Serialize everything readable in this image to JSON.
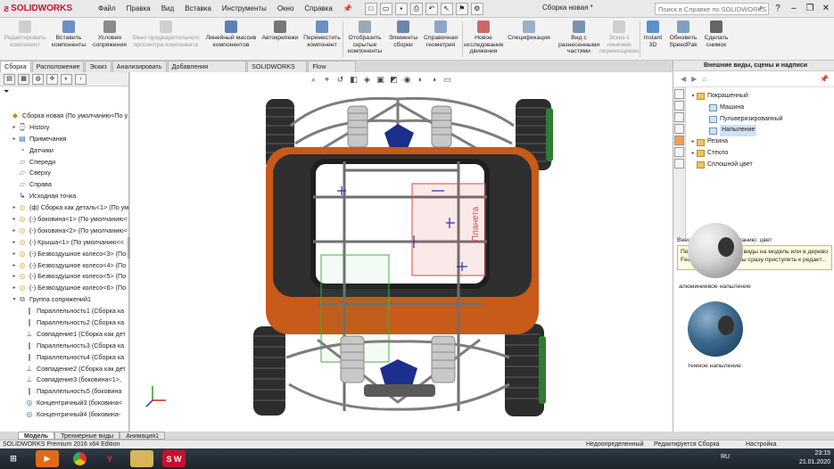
{
  "app": {
    "logo": "SOLIDWORKS",
    "doc_title": "Сборка новая *",
    "help_search_placeholder": "Поиск в Справке по SOLIDWORKS"
  },
  "menu": [
    "Файл",
    "Правка",
    "Вид",
    "Вставка",
    "Инструменты",
    "Окно",
    "Справка"
  ],
  "command_manager": [
    {
      "label": "Редактировать компонент",
      "enabled": false
    },
    {
      "label": "Вставить компоненты",
      "enabled": true
    },
    {
      "label": "Условия сопряжения",
      "enabled": true
    },
    {
      "label": "Окно предварительного просмотра компонента",
      "enabled": false
    },
    {
      "label": "Линейный массив компонентов",
      "enabled": true
    },
    {
      "label": "Автокрепежи",
      "enabled": true
    },
    {
      "label": "Переместить компонент",
      "enabled": true
    },
    {
      "label": "Отобразить скрытые компоненты",
      "enabled": true
    },
    {
      "label": "Элементы сборки",
      "enabled": true
    },
    {
      "label": "Справочная геометрия",
      "enabled": true
    },
    {
      "label": "Новое исследование движения",
      "enabled": true
    },
    {
      "label": "Спецификация",
      "enabled": true
    },
    {
      "label": "Вид с разнесенными частями",
      "enabled": true
    },
    {
      "label": "Эскиз с линиями перемещения",
      "enabled": false
    },
    {
      "label": "Instant 3D",
      "enabled": true
    },
    {
      "label": "Обновить SpeedPak",
      "enabled": true
    },
    {
      "label": "Сделать снимок",
      "enabled": true
    }
  ],
  "command_tabs": [
    "Сборка",
    "Расположение",
    "Эскиз",
    "Анализировать",
    "Добавления SOLIDWORKS",
    "SOLIDWORKS MBD",
    "Flow Simulation"
  ],
  "feature_tree": [
    {
      "label": "Сборка новая  (По умолчанию<По у",
      "level": 0,
      "twist": "",
      "icon": "assembly"
    },
    {
      "label": "History",
      "level": 1,
      "twist": "▸",
      "icon": "history"
    },
    {
      "label": "Примечания",
      "level": 1,
      "twist": "▸",
      "icon": "notes"
    },
    {
      "label": "Датчики",
      "level": 1,
      "twist": "",
      "icon": "sensor"
    },
    {
      "label": "Спереди",
      "level": 1,
      "twist": "",
      "icon": "plane"
    },
    {
      "label": "Сверху",
      "level": 1,
      "twist": "",
      "icon": "plane"
    },
    {
      "label": "Справа",
      "level": 1,
      "twist": "",
      "icon": "plane"
    },
    {
      "label": "Исходная точка",
      "level": 1,
      "twist": "",
      "icon": "origin"
    },
    {
      "label": "(ф) Сборка как деталь<1> (По ум",
      "level": 1,
      "twist": "▸",
      "icon": "part"
    },
    {
      "label": "(-) боковина<1> (По умолчанию<",
      "level": 1,
      "twist": "▸",
      "icon": "part"
    },
    {
      "label": "(-) боковина<2> (По умолчанию<",
      "level": 1,
      "twist": "▸",
      "icon": "part"
    },
    {
      "label": "(-) Крыша<1> (По умолчанию<<",
      "level": 1,
      "twist": "▸",
      "icon": "part"
    },
    {
      "label": "(-) Безвоздушное колесо<3> (По",
      "level": 1,
      "twist": "▸",
      "icon": "part"
    },
    {
      "label": "(-) Безвоздушное колесо<4> (По",
      "level": 1,
      "twist": "▸",
      "icon": "part"
    },
    {
      "label": "(-) Безвоздушное колесо<5> (По",
      "level": 1,
      "twist": "▸",
      "icon": "part"
    },
    {
      "label": "(-) Безвоздушное колесо<6> (По",
      "level": 1,
      "twist": "▸",
      "icon": "part"
    },
    {
      "label": "Группа сопряжений1",
      "level": 1,
      "twist": "▾",
      "icon": "mates"
    },
    {
      "label": "Параллельность1 (Сборка ка",
      "level": 2,
      "twist": "",
      "icon": "parallel"
    },
    {
      "label": "Параллельность2 (Сборка ка",
      "level": 2,
      "twist": "",
      "icon": "parallel"
    },
    {
      "label": "Совпадение1 (Сборка как дет",
      "level": 2,
      "twist": "",
      "icon": "coincident"
    },
    {
      "label": "Параллельность3 (Сборка ка",
      "level": 2,
      "twist": "",
      "icon": "parallel"
    },
    {
      "label": "Параллельность4 (Сборка ка",
      "level": 2,
      "twist": "",
      "icon": "parallel"
    },
    {
      "label": "Совпадение2 (Сборка как дет",
      "level": 2,
      "twist": "",
      "icon": "coincident"
    },
    {
      "label": "Совпадение3 (боковина<1>,",
      "level": 2,
      "twist": "",
      "icon": "coincident"
    },
    {
      "label": "Параллельность5 (боковина",
      "level": 2,
      "twist": "",
      "icon": "parallel"
    },
    {
      "label": "Концентричный3 (боковина<",
      "level": 2,
      "twist": "",
      "icon": "concentric"
    },
    {
      "label": "Концентричный4 (боковина-",
      "level": 2,
      "twist": "",
      "icon": "concentric"
    }
  ],
  "bottom_tabs": [
    "Модель",
    "Трехмерные виды",
    "Анимация1"
  ],
  "task_pane": {
    "title": "Внешние виды, сцены и надписи",
    "tree": [
      {
        "label": "Покрашенный",
        "level": 1,
        "twist": "▾",
        "selected": false
      },
      {
        "label": "Машина",
        "level": 2,
        "twist": "",
        "selected": false
      },
      {
        "label": "Пульверизированный",
        "level": 2,
        "twist": "",
        "selected": false
      },
      {
        "label": "Напыление",
        "level": 2,
        "twist": "",
        "selected": true
      },
      {
        "label": "Резина",
        "level": 1,
        "twist": "▸",
        "selected": false
      },
      {
        "label": "Стекло",
        "level": 1,
        "twist": "▸",
        "selected": false
      },
      {
        "label": "Сплошной цвет",
        "level": 1,
        "twist": "",
        "selected": false
      }
    ],
    "default_label": "Внешний вид по умолчанию: цвет",
    "hint": "Перетащите внешние виды на модель или в дерево FeatureManager.  Чтобы сразу приступить к редакт...",
    "swatches": [
      "алюминиевое напыление",
      "темное напыление"
    ]
  },
  "status": {
    "edition": "SOLIDWORKS Premium 2016 x64 Edition",
    "state": "Недоопределенный",
    "editing": "Редактируется Сборка",
    "custom": "Настройка"
  },
  "taskbar": {
    "lang": "RU",
    "time": "23:15",
    "date": "21.01.2020",
    "sw_label": "S W"
  },
  "viewport": {
    "frame_color": "#3a3a3a",
    "body_color": "#c85a1a",
    "spring_color": "#c8c8c8",
    "hub_color": "#1d2f8c",
    "sketch_color": "#d64a4a",
    "sketch_text": "Планета"
  }
}
